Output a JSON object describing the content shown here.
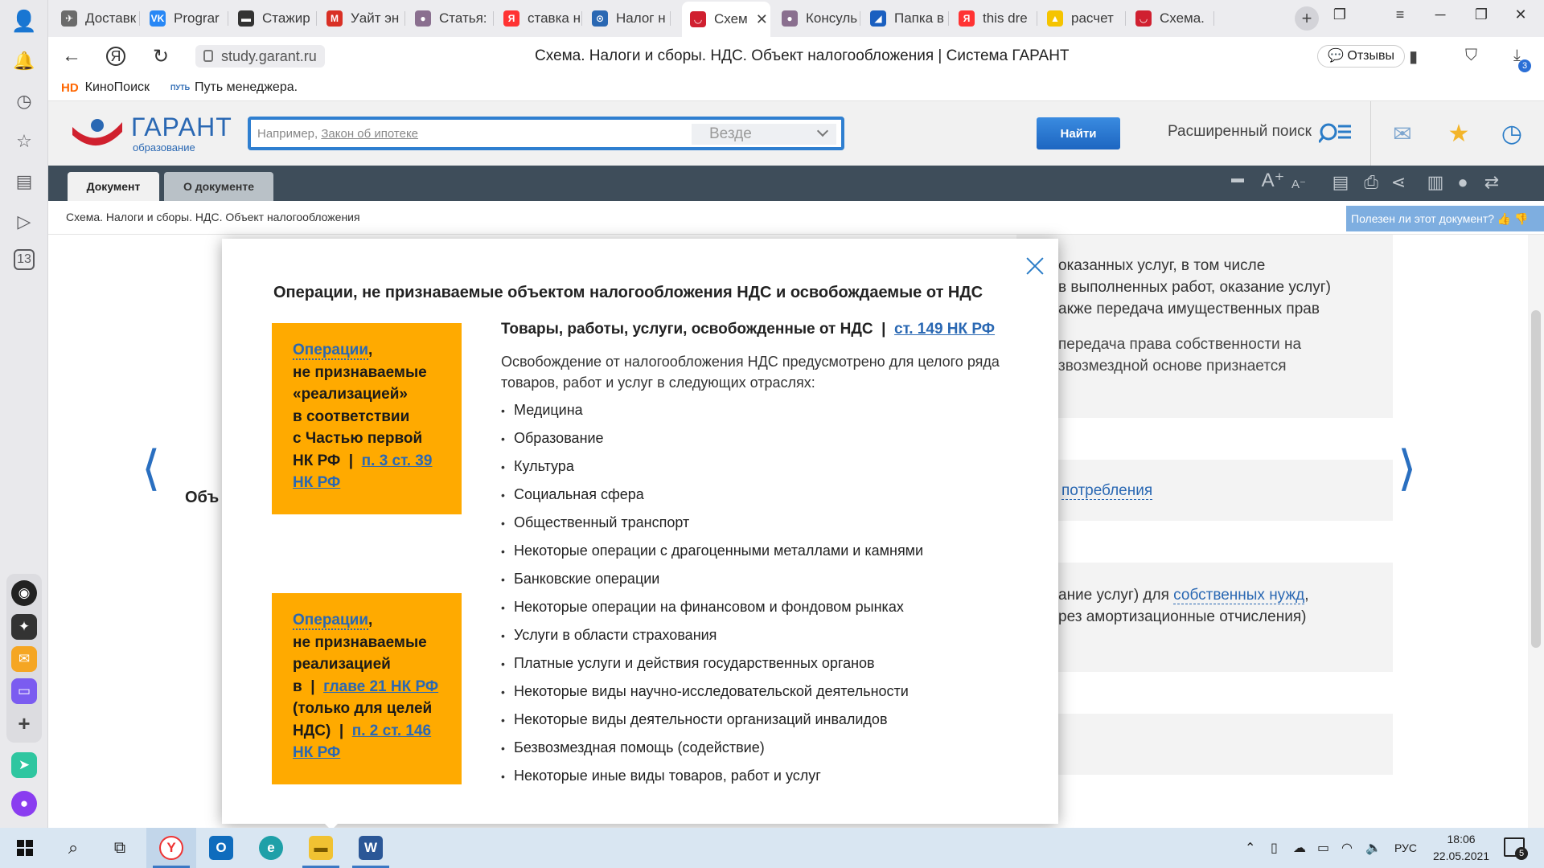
{
  "browser": {
    "tabs": [
      {
        "label": "Доставк",
        "fav_color": "#6b6b6b",
        "fav_glyph": "✈"
      },
      {
        "label": "Prograr",
        "fav_color": "#2787f5",
        "fav_glyph": "VK"
      },
      {
        "label": "Стажир",
        "fav_color": "#333333",
        "fav_glyph": "▬"
      },
      {
        "label": "Уайт эн",
        "fav_color": "#d93025",
        "fav_glyph": "M"
      },
      {
        "label": "Статья:",
        "fav_color": "#8a6f8f",
        "fav_glyph": "●"
      },
      {
        "label": "ставка н",
        "fav_color": "#f33",
        "fav_glyph": "Я"
      },
      {
        "label": "Налог н",
        "fav_color": "#2a68b3",
        "fav_glyph": "⊙"
      },
      {
        "label": "Схем",
        "fav_color": "#d02030",
        "fav_glyph": "◡",
        "active": true
      },
      {
        "label": "Консуль",
        "fav_color": "#8a6f8f",
        "fav_glyph": "●"
      },
      {
        "label": "Папка в",
        "fav_color": "#1a5fc0",
        "fav_glyph": "◢"
      },
      {
        "label": "this dre",
        "fav_color": "#f33",
        "fav_glyph": "Я"
      },
      {
        "label": "расчет",
        "fav_color": "#f5c400",
        "fav_glyph": "▲"
      },
      {
        "label": "Схема.",
        "fav_color": "#d02030",
        "fav_glyph": "◡"
      }
    ],
    "address": {
      "url": "study.garant.ru",
      "page_title": "Схема. Налоги и сборы. НДС. Объект налогообложения | Система ГАРАНТ",
      "reviews_label": "Отзывы",
      "downloads_badge": "3"
    },
    "bookmarks": [
      {
        "label": "КиноПоиск",
        "icon": "HD"
      },
      {
        "label": "Путь менеджера.",
        "icon": "ПУТЬ"
      }
    ]
  },
  "garant": {
    "logo_name": "ГАРАНТ",
    "logo_sub": "образование",
    "search_hint_prefix": "Например,",
    "search_hint_link": "Закон об ипотеке",
    "scope": "Везде",
    "find_button": "Найти",
    "advanced_search": "Расширенный поиск",
    "doc_tabs": [
      "Документ",
      "О документе"
    ],
    "breadcrumb": "Схема. Налоги и сборы. НДС. Объект налогообложения",
    "useful_prompt": "Полезен ли этот документ?"
  },
  "background_doc": {
    "lines_block1": [
      "оказанных услуг, в том числе",
      "в выполненных работ, оказание услуг)",
      "акже передача имущественных прав",
      "передача права собственности на",
      "звозмездной основе признается"
    ],
    "block2_link": "потребления",
    "block3_prefix": "ание услуг) для",
    "block3_link": "собственных нужд",
    "block3_suffix": ",",
    "block3_line2": "рез амортизационные отчисления)",
    "left_label": "Объ"
  },
  "modal": {
    "title": "Операции, не признаваемые объектом налогообложения НДС и освобождаемые от НДС",
    "box1": {
      "link": "Операции",
      "comma": ",",
      "lines": [
        "не признаваемые",
        "«реализацией»",
        "в соответствии",
        "с Частью первой"
      ],
      "nk_prefix": "НК РФ  |  ",
      "nk_link_1": "п. 3 ст. 39",
      "nk_link_2": "НК РФ"
    },
    "box2": {
      "link": "Операции",
      "comma": ",",
      "lines": [
        "не признаваемые",
        "реализацией"
      ],
      "chapter_prefix": "в  |  ",
      "chapter_link": "главе 21 НК РФ",
      "line_purpose": "(только для целей",
      "nds_prefix": "НДС)  |  ",
      "nds_link_1": "п. 2 ст. 146",
      "nds_link_2": "НК РФ"
    },
    "right": {
      "heading": "Товары, работы, услуги, освобожденные от НДС",
      "heading_sep": "  |  ",
      "heading_link": "ст. 149 НК РФ",
      "description": "Освобождение от налогообложения НДС предусмотрено для целого ряда товаров, работ и услуг в следующих отраслях:",
      "items": [
        "Медицина",
        "Образование",
        "Культура",
        "Социальная сфера",
        "Общественный транспорт",
        "Некоторые операции с драгоценными металлами и камнями",
        "Банковские операции",
        "Некоторые операции на финансовом и фондовом рынках",
        "Услуги в области страхования",
        "Платные услуги и действия государственных органов",
        "Некоторые виды научно-исследовательской деятельности",
        "Некоторые виды деятельности организаций инвалидов",
        "Безвозмездная помощь (содействие)",
        "Некоторые иные виды товаров, работ и услуг"
      ]
    }
  },
  "taskbar": {
    "language": "РУС",
    "time": "18:06",
    "date": "22.05.2021",
    "notifications": "5"
  },
  "colors": {
    "accent": "#2a68b3",
    "orange_box": "#ffaa00",
    "doc_tabbar": "#3e4d5a",
    "find_button": "#1d66c1"
  }
}
